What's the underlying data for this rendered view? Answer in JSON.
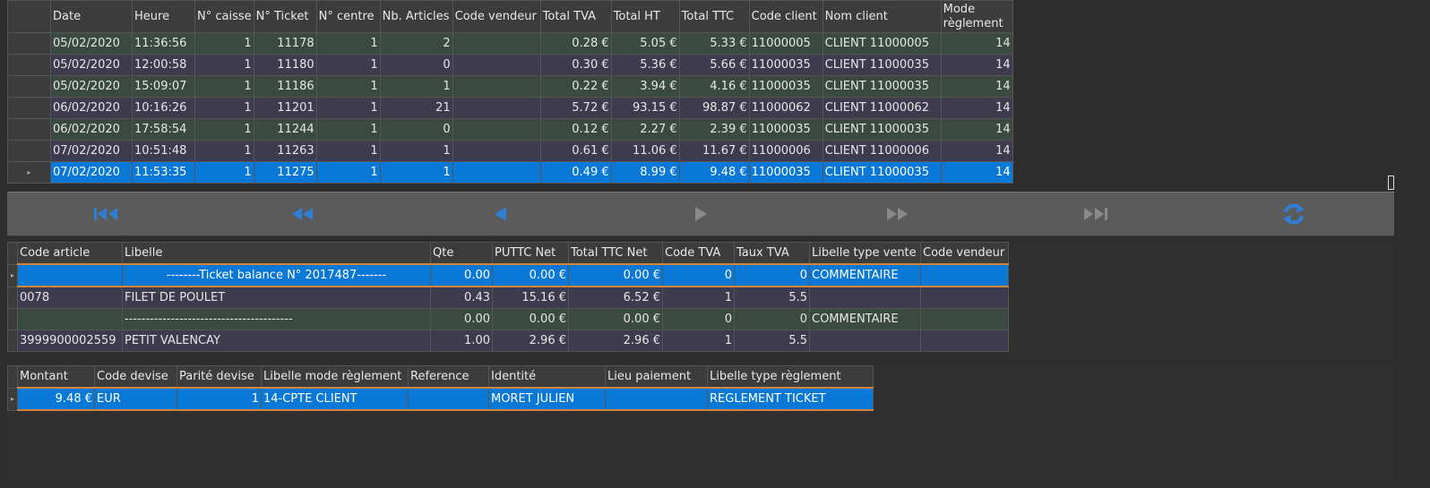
{
  "tickets": {
    "headers": [
      "Date",
      "Heure",
      "N° caisse",
      "N° Ticket",
      "N° centre",
      "Nb. Articles",
      "Code vendeur",
      "Total TVA",
      "Total HT",
      "Total TTC",
      "Code client",
      "Nom client",
      "Mode\nrèglement"
    ],
    "rows": [
      [
        "05/02/2020",
        "11:36:56",
        "1",
        "11178",
        "1",
        "2",
        "",
        "0.28 €",
        "5.05 €",
        "5.33 €",
        "11000005",
        "CLIENT  11000005",
        "14"
      ],
      [
        "05/02/2020",
        "12:00:58",
        "1",
        "11180",
        "1",
        "0",
        "",
        "0.30 €",
        "5.36 €",
        "5.66 €",
        "11000035",
        "CLIENT  11000035",
        "14"
      ],
      [
        "05/02/2020",
        "15:09:07",
        "1",
        "11186",
        "1",
        "1",
        "",
        "0.22 €",
        "3.94 €",
        "4.16 €",
        "11000035",
        "CLIENT  11000035",
        "14"
      ],
      [
        "06/02/2020",
        "10:16:26",
        "1",
        "11201",
        "1",
        "21",
        "",
        "5.72 €",
        "93.15 €",
        "98.87 €",
        "11000062",
        "CLIENT  11000062",
        "14"
      ],
      [
        "06/02/2020",
        "17:58:54",
        "1",
        "11244",
        "1",
        "0",
        "",
        "0.12 €",
        "2.27 €",
        "2.39 €",
        "11000035",
        "CLIENT  11000035",
        "14"
      ],
      [
        "07/02/2020",
        "10:51:48",
        "1",
        "11263",
        "1",
        "1",
        "",
        "0.61 €",
        "11.06 €",
        "11.67 €",
        "11000006",
        "CLIENT  11000006",
        "14"
      ],
      [
        "07/02/2020",
        "11:53:35",
        "1",
        "11275",
        "1",
        "1",
        "",
        "0.49 €",
        "8.99 €",
        "9.48 €",
        "11000035",
        "CLIENT  11000035",
        "14"
      ]
    ],
    "selected_index": 6
  },
  "navigation": {
    "icons": [
      "first-icon",
      "rewind-icon",
      "previous-icon",
      "next-icon",
      "fast-forward-icon",
      "last-icon",
      "refresh-icon"
    ],
    "colors": {
      "active": "#2f7fd6",
      "disabled": "#8a8a8a"
    }
  },
  "articles": {
    "headers": [
      "Code article",
      "Libelle",
      "Qte",
      "PUTTC Net",
      "Total TTC Net",
      "Code TVA",
      "Taux TVA",
      "Libelle type vente",
      "Code vendeur"
    ],
    "rows": [
      [
        "",
        "--------Ticket balance N° 2017487-------",
        "0.00",
        "0.00 €",
        "0.00 €",
        "0",
        "0",
        "COMMENTAIRE",
        ""
      ],
      [
        "0078",
        "FILET DE POULET",
        "0.43",
        "15.16 €",
        "6.52 €",
        "1",
        "5.5",
        "",
        ""
      ],
      [
        "",
        "----------------------------------------",
        "0.00",
        "0.00 €",
        "0.00 €",
        "0",
        "0",
        "COMMENTAIRE",
        ""
      ],
      [
        "3999900002559",
        "PETIT VALENCAY",
        "1.00",
        "2.96 €",
        "2.96 €",
        "1",
        "5.5",
        "",
        ""
      ]
    ],
    "selected_index": 0
  },
  "payments": {
    "headers": [
      "Montant",
      "Code devise",
      "Parité devise",
      "Libelle mode règlement",
      "Reference",
      "Identité",
      "Lieu paiement",
      "Libelle type règlement"
    ],
    "rows": [
      [
        "9.48 €",
        "EUR",
        "1",
        "14-CPTE CLIENT",
        "",
        "MORET JULIEN",
        "",
        "REGLEMENT TICKET"
      ]
    ],
    "selected_index": 0
  },
  "colors": {
    "row_green": "#3b4a40",
    "row_purple": "#3f3b4e",
    "selection": "#0a78d7",
    "selection_border": "#d1843a",
    "background": "#2d2d2d"
  }
}
